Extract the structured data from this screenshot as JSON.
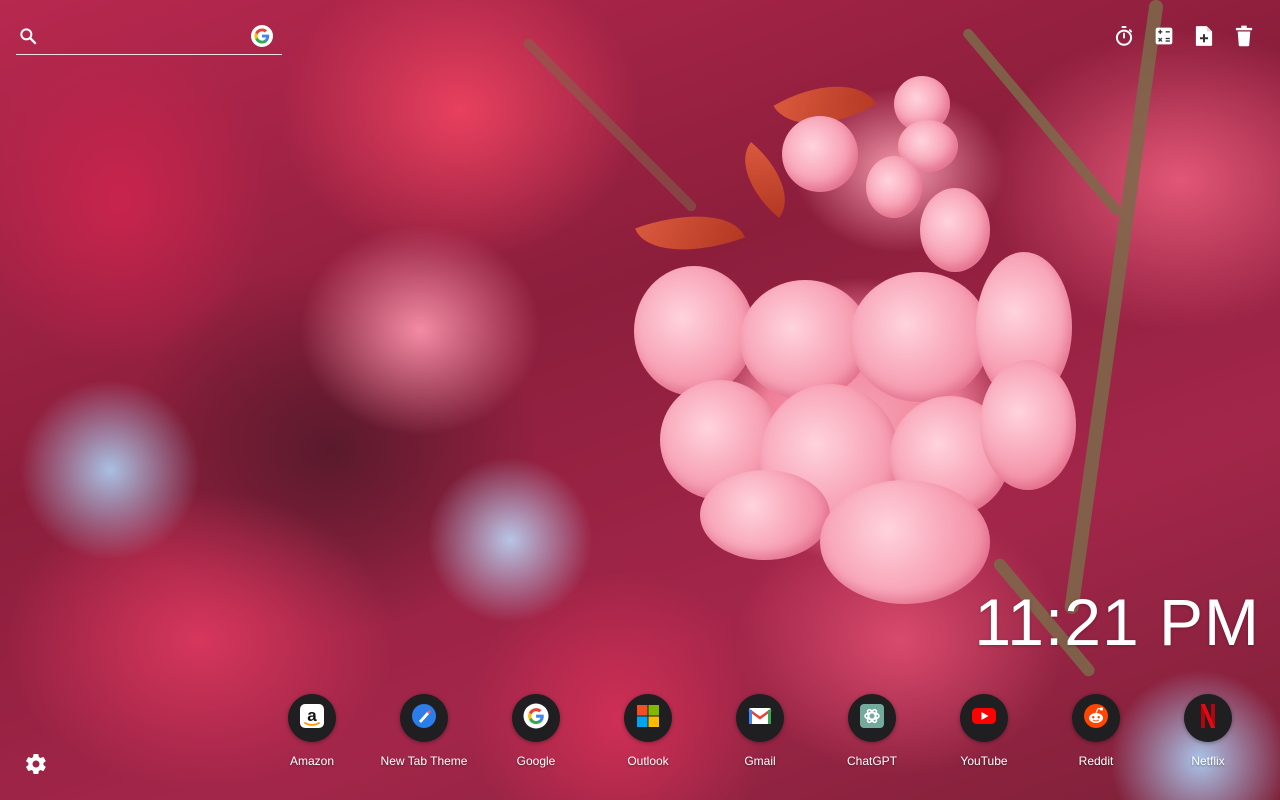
{
  "search": {
    "placeholder": "",
    "value": "",
    "engine_icon": "google-g-icon"
  },
  "toolbar": {
    "items": [
      {
        "icon": "stopwatch-icon"
      },
      {
        "icon": "calculator-icon"
      },
      {
        "icon": "note-add-icon"
      },
      {
        "icon": "trash-icon"
      }
    ]
  },
  "clock": {
    "time": "11:21 PM"
  },
  "shortcuts": [
    {
      "label": "Amazon",
      "icon": "amazon-icon"
    },
    {
      "label": "New Tab Theme",
      "icon": "new-tab-theme-icon"
    },
    {
      "label": "Google",
      "icon": "google-icon"
    },
    {
      "label": "Outlook",
      "icon": "outlook-icon"
    },
    {
      "label": "Gmail",
      "icon": "gmail-icon"
    },
    {
      "label": "ChatGPT",
      "icon": "chatgpt-icon"
    },
    {
      "label": "YouTube",
      "icon": "youtube-icon"
    },
    {
      "label": "Reddit",
      "icon": "reddit-icon"
    },
    {
      "label": "Netflix",
      "icon": "netflix-icon"
    }
  ],
  "settings": {
    "icon": "gear-icon"
  },
  "colors": {
    "shortcut_bg": "#1f1f22",
    "text": "#ffffff",
    "google_blue": "#4285F4",
    "google_red": "#EA4335",
    "google_yellow": "#FBBC05",
    "google_green": "#34A853",
    "youtube_red": "#FF0000",
    "reddit_orange": "#FF4500",
    "netflix_red": "#E50914"
  }
}
